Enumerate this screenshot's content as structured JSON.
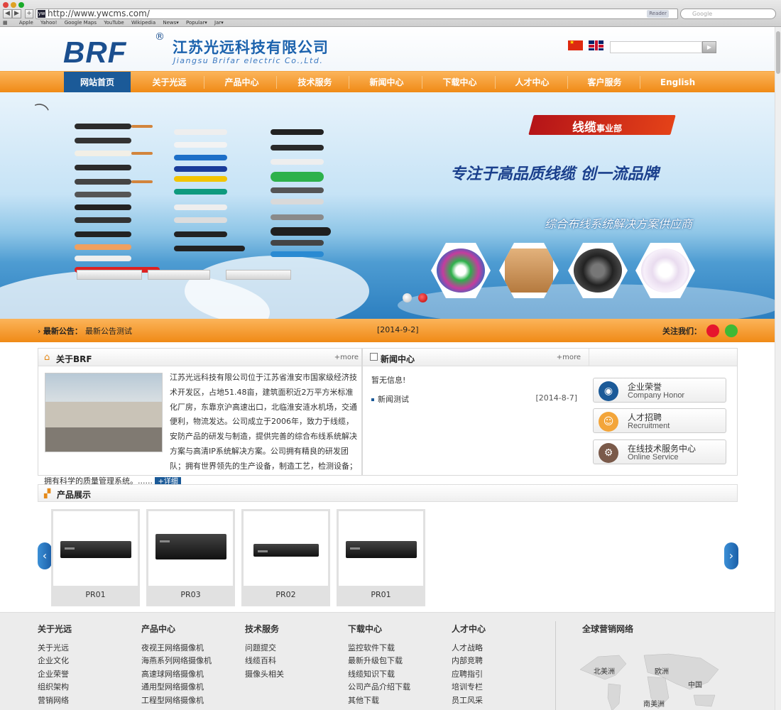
{
  "browser": {
    "url": "http://www.ywcms.com/",
    "reader": "Reader",
    "search_placeholder": "Google",
    "favicon": "yw",
    "bookmarks": [
      "Apple",
      "Yahoo!",
      "Google Maps",
      "YouTube",
      "Wikipedia",
      "News▾",
      "Popular▾",
      "Jar▾"
    ]
  },
  "header": {
    "logo_text": "BRF",
    "logo_reg": "®",
    "company_cn": "江苏光远科技有限公司",
    "company_en": "Jiangsu Brifar electric Co.,Ltd."
  },
  "nav": {
    "items": [
      {
        "label": "网站首页",
        "active": true
      },
      {
        "label": "关于光远"
      },
      {
        "label": "产品中心"
      },
      {
        "label": "技术服务"
      },
      {
        "label": "新闻中心"
      },
      {
        "label": "下载中心"
      },
      {
        "label": "人才中心"
      },
      {
        "label": "客户服务"
      },
      {
        "label": "English"
      }
    ]
  },
  "banner": {
    "tag_main": "线缆",
    "tag_sub": "事业部",
    "slogan": "专注于高品质线缆  创一流品牌",
    "subslogan": "综合布线系统解决方案供应商"
  },
  "notice": {
    "label": "最新公告：",
    "text": "最新公告测试",
    "date": "[2014-9-2]",
    "follow": "关注我们："
  },
  "about": {
    "title": "关于BRF",
    "more": "+more",
    "text": "江苏光远科技有限公司位于江苏省淮安市国家级经济技术开发区，占地51.48亩，建筑面积近2万平方米标准化厂房，东靠京沪高速出口，北临淮安涟水机场，交通便利，物流发达。公司成立于2006年，致力于线缆，安防产品的研发与制造，提供完善的综合布线系统解决方案与高清IP系统解决方案。公司拥有精良的研发团队；拥有世界领先的生产设备，制造工艺，检测设备；拥有科学的质量管理系统。......",
    "detail_btn": "+详细"
  },
  "news": {
    "title": "新闻中心",
    "more": "+more",
    "empty": "暂无信息!",
    "items": [
      {
        "title": "新闻测试",
        "date": "[2014-8-7]"
      }
    ]
  },
  "side_buttons": [
    {
      "cn": "企业荣誉",
      "en": "Company Honor",
      "color": "#1b5a98"
    },
    {
      "cn": "人才招聘",
      "en": "Recruitment",
      "color": "#f3a53a"
    },
    {
      "cn": "在线技术服务中心",
      "en": "Online Service",
      "color": "#7a5a4a"
    }
  ],
  "products": {
    "title": "产品展示",
    "items": [
      {
        "name": "PR01"
      },
      {
        "name": "PR03"
      },
      {
        "name": "PR02"
      },
      {
        "name": "PR01"
      }
    ],
    "prev_arrow": "‹",
    "next_arrow": "›"
  },
  "footer": {
    "columns": [
      {
        "title": "关于光远",
        "links": [
          "关于光远",
          "企业文化",
          "企业荣誉",
          "组织架构",
          "营销网络"
        ]
      },
      {
        "title": "产品中心",
        "links": [
          "夜视王网络摄像机",
          "海燕系列网络摄像机",
          "高速球网络摄像机",
          "通用型网络摄像机",
          "工程型网络摄像机"
        ]
      },
      {
        "title": "技术服务",
        "links": [
          "问题提交",
          "线缆百科",
          "摄像头相关"
        ]
      },
      {
        "title": "下载中心",
        "links": [
          "监控软件下载",
          "最新升级包下载",
          "线缆知识下载",
          "公司产品介绍下载",
          "其他下载"
        ]
      },
      {
        "title": "人才中心",
        "links": [
          "人才战略",
          "内部竞聘",
          "应聘指引",
          "培训专栏",
          "员工风采"
        ]
      }
    ],
    "global_title": "全球营销网络",
    "map_labels": [
      "北美洲",
      "欧洲",
      "中国",
      "南美洲"
    ]
  }
}
